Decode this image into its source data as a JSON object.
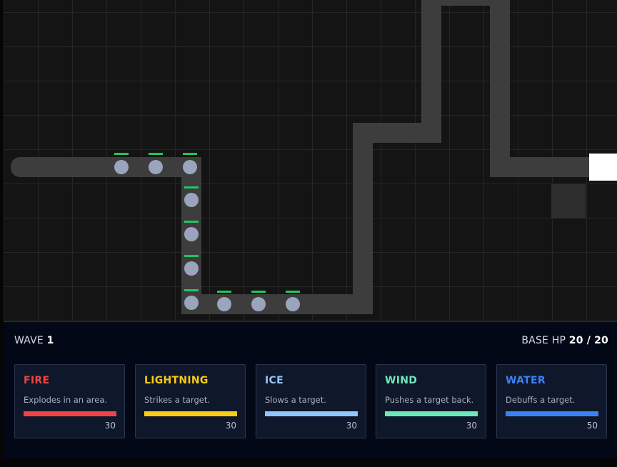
{
  "hud": {
    "wave_label": "WAVE",
    "wave_value": "1",
    "base_hp_label": "BASE HP",
    "base_hp_current": "20",
    "base_hp_sep": " / ",
    "base_hp_max": "20"
  },
  "towers": [
    {
      "name": "FIRE",
      "description": "Explodes in an area.",
      "cost": "30",
      "color": "#ef4444"
    },
    {
      "name": "LIGHTNING",
      "description": "Strikes a target.",
      "cost": "30",
      "color": "#facc15"
    },
    {
      "name": "ICE",
      "description": "Slows a target.",
      "cost": "30",
      "color": "#93c5fd"
    },
    {
      "name": "WIND",
      "description": "Pushes a target back.",
      "cost": "30",
      "color": "#6ee7b7"
    },
    {
      "name": "WATER",
      "description": "Debuffs a target.",
      "cost": "50",
      "color": "#3b82f6"
    }
  ],
  "colors": {
    "path": "#3d3d3d",
    "enemy": "#9aa5bd",
    "enemy_health": "#22c55e",
    "base": "#ffffff",
    "build_slot": "#2e2e2e"
  },
  "icons": {
    "enemy": "circle",
    "base": "square"
  }
}
